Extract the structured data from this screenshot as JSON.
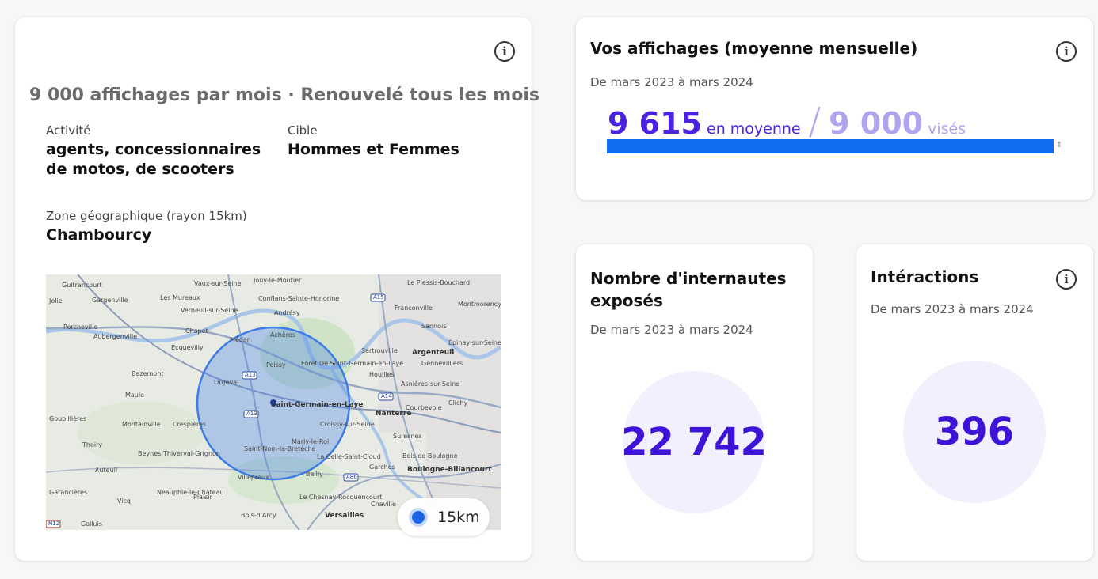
{
  "left_card": {
    "headline": "9 000 affichages par mois · Renouvelé tous les mois",
    "activity_label": "Activité",
    "activity_line1": "agents, concessionnaires",
    "activity_line2": "de motos, de scooters",
    "target_label": "Cible",
    "target_value": "Hommes et Femmes",
    "zone_label": "Zone géographique (rayon 15km)",
    "zone_value": "Chambourcy",
    "map": {
      "legend": "15km",
      "places": [
        "Guitrancourt",
        "Vaux-sur-Seine",
        "Jouy-le-Moutier",
        "Le Plessis-Bouchard",
        "Jolie",
        "Gargenville",
        "Les Mureaux",
        "Conflans-Sainte-Honorine",
        "Franconville",
        "Montmorency",
        "Verneuil-sur-Seine",
        "Andrésy",
        "Porcheville",
        "Sannois",
        "Aubergenville",
        "Chapet",
        "Achères",
        "Épinay-sur-Seine",
        "Médan",
        "Sartrouville",
        "Argenteuil",
        "Ecquevilly",
        "Gennevilliers",
        "Poissy",
        "Forêt De Saint-Germain-en-Laye",
        "Bazemont",
        "Houilles",
        "Orgeval",
        "Asnières-sur-Seine",
        "Maule",
        "Clichy",
        "Saint-Germain-en-Laye",
        "Courbevoie",
        "Nanterre",
        "Goupillières",
        "Montainville",
        "Crespières",
        "Croissy-sur-Seine",
        "Thoiry",
        "Suresnes",
        "Marly-le-Roi",
        "Saint-Nom-la-Bretèche",
        "Beynes",
        "Thiverval-Grignon",
        "La Celle-Saint-Cloud",
        "Bois de Boulogne",
        "Auteuil",
        "Garches",
        "Boulogne-Billancourt",
        "Bailly",
        "Villepreux",
        "Garancières",
        "Neauphle-le-Château",
        "Plaisir",
        "Le Chesnay-Rocquencourt",
        "Vicq",
        "Chaville",
        "Galluis",
        "Bois-d'Arcy",
        "Versailles"
      ],
      "road_labels": [
        "A15",
        "A13",
        "A13",
        "A14",
        "A86",
        "N12"
      ]
    }
  },
  "top_card": {
    "title": "Vos affichages (moyenne mensuelle)",
    "period": "De mars 2023 à mars 2024",
    "average_value": "9 615",
    "average_label": "en moyenne",
    "separator": "/",
    "target_value": "9 000",
    "target_label": "visés",
    "progress_fraction": 1.0,
    "progress_color": "#0f6ef0",
    "handle": "⇕"
  },
  "users_card": {
    "title_line1": "Nombre d'internautes",
    "title_line2": "exposés",
    "period": "De mars 2023 à mars 2024",
    "value": "22 742"
  },
  "interactions_card": {
    "title": "Intéractions",
    "period": "De mars 2023 à mars 2024",
    "value": "396"
  },
  "colors": {
    "accent": "#3d14d6",
    "accent_light": "#b2a3ee",
    "bar": "#0f6ef0"
  }
}
